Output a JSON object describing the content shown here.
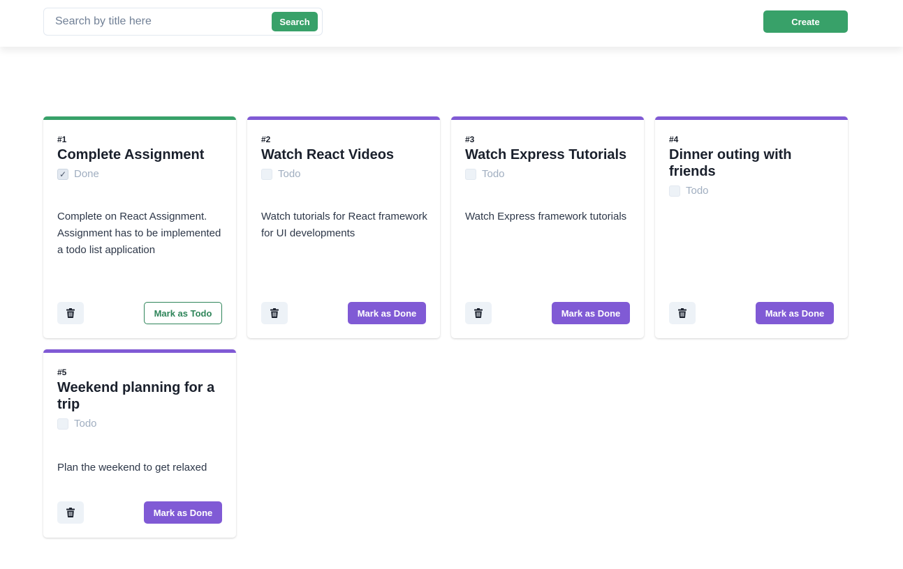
{
  "header": {
    "search_placeholder": "Search by title here",
    "search_label": "Search",
    "create_label": "Create"
  },
  "colors": {
    "accent_green": "#38a169",
    "accent_purple": "#805ad5"
  },
  "tasks": [
    {
      "number": "#1",
      "title": "Complete Assignment",
      "status": "Done",
      "checked": true,
      "description": "Complete on React Assignment. Assignment has to be implemented a todo list application",
      "action_label": "Mark as Todo",
      "delete_icon": "trash-icon"
    },
    {
      "number": "#2",
      "title": "Watch React Videos",
      "status": "Todo",
      "checked": false,
      "description": "Watch tutorials for React framework for UI developments",
      "action_label": "Mark as Done",
      "delete_icon": "trash-icon"
    },
    {
      "number": "#3",
      "title": "Watch Express Tutorials",
      "status": "Todo",
      "checked": false,
      "description": "Watch Express framework tutorials",
      "action_label": "Mark as Done",
      "delete_icon": "trash-icon"
    },
    {
      "number": "#4",
      "title": "Dinner outing with friends",
      "status": "Todo",
      "checked": false,
      "description": "",
      "action_label": "Mark as Done",
      "delete_icon": "trash-icon"
    },
    {
      "number": "#5",
      "title": "Weekend planning for a trip",
      "status": "Todo",
      "checked": false,
      "description": "Plan the weekend to get relaxed",
      "action_label": "Mark as Done",
      "delete_icon": "trash-icon"
    }
  ]
}
